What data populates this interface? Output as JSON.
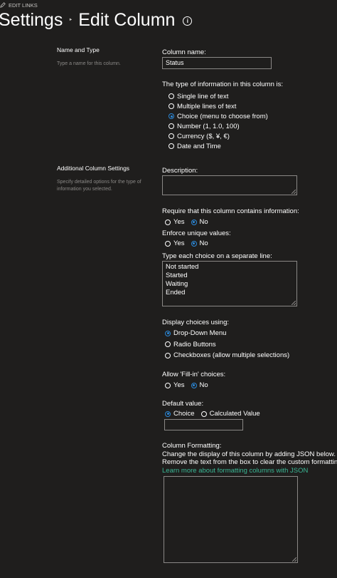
{
  "topbar": {
    "edit_links": "EDIT LINKS"
  },
  "header": {
    "crumb_settings": "Settings",
    "crumb_separator": "‣",
    "page_title": "Edit Column",
    "info_icon": "i"
  },
  "name_type": {
    "heading": "Name and Type",
    "description": "Type a name for this column.",
    "column_name_label": "Column name:",
    "column_name_value": "Status",
    "type_label": "The type of information in this column is:",
    "types": [
      {
        "label": "Single line of text",
        "selected": false
      },
      {
        "label": "Multiple lines of text",
        "selected": false
      },
      {
        "label": "Choice (menu to choose from)",
        "selected": true
      },
      {
        "label": "Number (1, 1.0, 100)",
        "selected": false
      },
      {
        "label": "Currency ($, ¥, €)",
        "selected": false
      },
      {
        "label": "Date and Time",
        "selected": false
      }
    ]
  },
  "additional": {
    "heading": "Additional Column Settings",
    "description": "Specify detailed options for the type of information you selected.",
    "description_label": "Description:",
    "require_label": "Require that this column contains information:",
    "require_yes": "Yes",
    "require_no": "No",
    "require_value": "No",
    "unique_label": "Enforce unique values:",
    "unique_yes": "Yes",
    "unique_no": "No",
    "unique_value": "No",
    "choices_label": "Type each choice on a separate line:",
    "choices": [
      "Not started",
      "Started",
      "Waiting",
      "Ended"
    ],
    "display_label": "Display choices using:",
    "display_options": [
      {
        "label": "Drop-Down Menu",
        "selected": true
      },
      {
        "label": "Radio Buttons",
        "selected": false
      },
      {
        "label": "Checkboxes (allow multiple selections)",
        "selected": false
      }
    ],
    "fillin_label": "Allow 'Fill-in' choices:",
    "fillin_yes": "Yes",
    "fillin_no": "No",
    "fillin_value": "No",
    "default_label": "Default value:",
    "default_choice": "Choice",
    "default_calculated": "Calculated Value",
    "default_selected": "Choice",
    "default_value": "",
    "formatting_label": "Column Formatting:",
    "formatting_line1": "Change the display of this column by adding JSON below.",
    "formatting_line2": "Remove the text from the box to clear the custom formatting.",
    "formatting_link": "Learn more about formatting columns with JSON"
  },
  "colors": {
    "background": "#1f1e1d",
    "accent": "#2b88d8",
    "link": "#3ab795",
    "muted": "#8a8886"
  }
}
